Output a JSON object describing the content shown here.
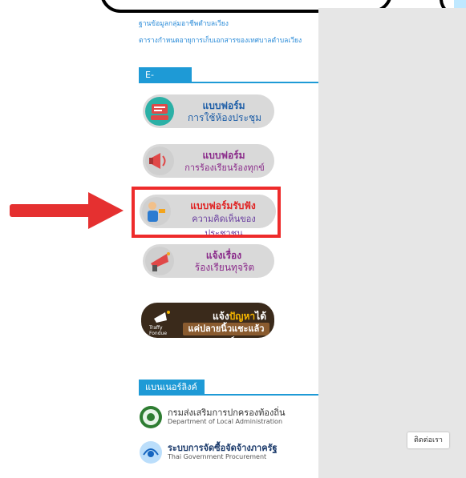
{
  "links": [
    "ฐานข้อมูลกลุ่มอาชีพตำบลเวียง",
    "ตารางกำหนดอายุการเก็บเอกสารของเทศบาลตำบลเวียง"
  ],
  "eservice": {
    "heading": "E-Service",
    "items": [
      {
        "line1": "แบบฟอร์ม",
        "line2": "การใช้ห้องประชุม",
        "color1": "#1f5fa8",
        "color2": "#1f5fa8"
      },
      {
        "line1": "แบบฟอร์ม",
        "line2": "การร้องเรียนร้องทุกข์",
        "color1": "#8a2a8a",
        "color2": "#8a2a8a"
      },
      {
        "line1": "แบบฟอร์มรับฟัง",
        "line2": "ความคิดเห็นของประชาชน",
        "color1": "#e02424",
        "color2": "#6a3fa0"
      },
      {
        "line1": "แจ้งเรื่อง",
        "line2": "ร้องเรียนทุจริต",
        "color1": "#8a2a8a",
        "color2": "#8a2a8a"
      }
    ],
    "banner": {
      "logo_text": "Traffy Fondue",
      "line1_a": "แจ้ง",
      "line1_b": "ปัญหา",
      "line1_c": "ได้",
      "line2": "แค่ปลายนิ้วแชะแล้วแชร์"
    }
  },
  "banner_links": {
    "heading": "แบนเนอร์ลิงค์",
    "orgs": [
      {
        "name_th": "กรมส่งเสริมการปกครองท้องถิ่น",
        "name_en": "Department of Local Administration"
      },
      {
        "name_th": "ระบบการจัดซื้อจัดจ้างภาครัฐ",
        "name_en": "Thai Government Procurement"
      }
    ]
  },
  "contact_button": "ติดต่อเรา",
  "colors": {
    "accent": "#1e9ad6",
    "highlight": "#ee2b2b",
    "arrow": "#e53030",
    "panel": "#e6e6e6"
  }
}
